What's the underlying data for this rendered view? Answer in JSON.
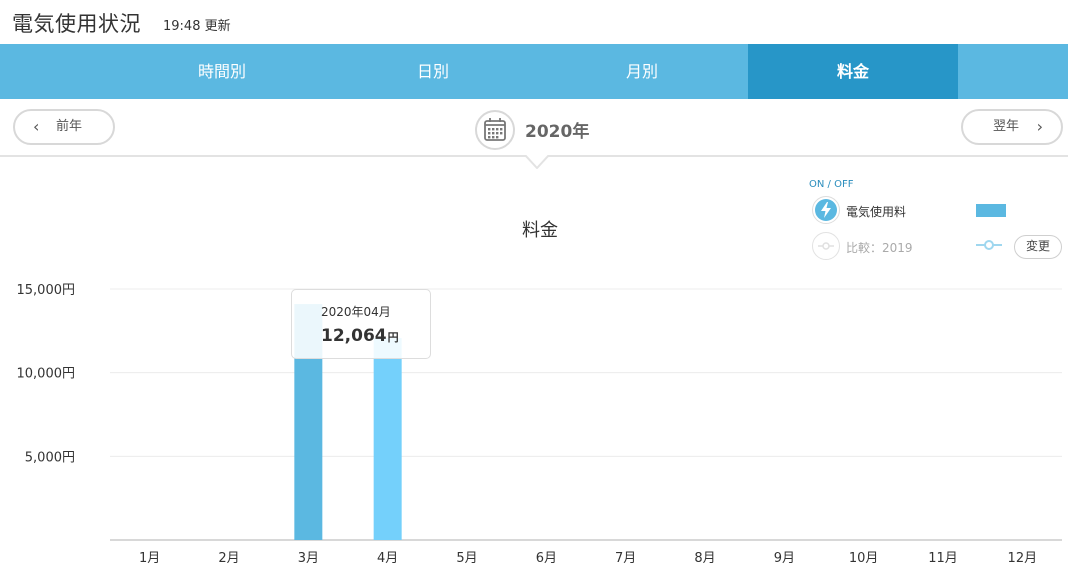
{
  "header": {
    "title": "電気使用状況",
    "updated": "19:48 更新"
  },
  "tabs": [
    {
      "label": "時間別",
      "active": false
    },
    {
      "label": "日別",
      "active": false
    },
    {
      "label": "月別",
      "active": false
    },
    {
      "label": "料金",
      "active": true
    }
  ],
  "nav": {
    "prev_label": "前年",
    "next_label": "翌年",
    "year": "2020年",
    "prev_icon": "chevron-left-icon",
    "next_icon": "chevron-right-icon",
    "calendar_icon": "calendar-icon"
  },
  "legend": {
    "onoff": "ON / OFF",
    "series1": "電気使用料",
    "series2": "比較：2019",
    "change_label": "変更",
    "bolt_icon": "lightning-icon",
    "compare_icon": "compare-line-icon"
  },
  "tooltip": {
    "date": "2020年04月",
    "value": "12,064",
    "unit": "円"
  },
  "colors": {
    "tab_bg": "#5bb8e1",
    "tab_active": "#2796c8",
    "bar_current": "#5bb8e1",
    "bar_highlight": "#74d0fb"
  },
  "chart_data": {
    "type": "bar",
    "title": "料金",
    "categories": [
      "1月",
      "2月",
      "3月",
      "4月",
      "5月",
      "6月",
      "7月",
      "8月",
      "9月",
      "10月",
      "11月",
      "12月"
    ],
    "series": [
      {
        "name": "電気使用料",
        "values": [
          0,
          0,
          14100,
          12064,
          0,
          0,
          0,
          0,
          0,
          0,
          0,
          0
        ]
      }
    ],
    "highlighted_index": 3,
    "y_ticks": [
      "5,000円",
      "10,000円",
      "15,000円"
    ],
    "y_tick_values": [
      5000,
      10000,
      15000
    ],
    "ylim": [
      0,
      15000
    ],
    "grid": true,
    "legend_position": "top-right"
  }
}
